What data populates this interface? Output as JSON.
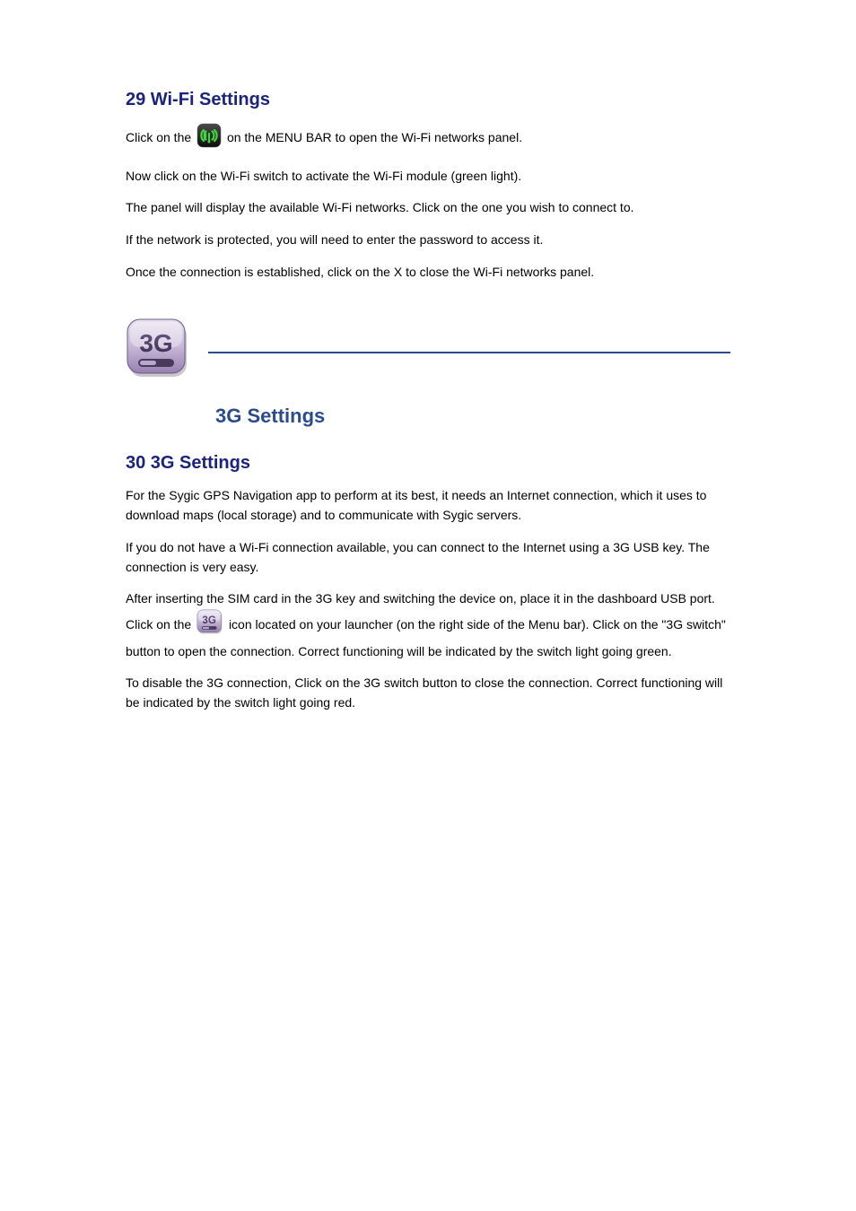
{
  "wifi": {
    "heading": "29 Wi-Fi Settings",
    "p1_a": "Click on the ",
    "p1_b": " on the MENU BAR to open the Wi-Fi networks panel.",
    "p2": "Now click on the Wi-Fi switch to activate the Wi-Fi module (green light).",
    "p3": "The panel will display the available Wi-Fi networks. Click on the one you wish to connect to.",
    "p4": "If the network is protected, you will need to enter the password to access it.",
    "p5": "Once the connection is established, click on the X to close the Wi-Fi networks panel."
  },
  "threeg": {
    "section_title": "3G Settings",
    "heading": "30 3G Settings",
    "p1": "For the Sygic GPS Navigation app to perform at its best, it needs an Internet connection, which it uses to download maps (local storage) and to communicate with Sygic servers.",
    "p2": "If you do not have a Wi-Fi connection available, you can connect to the Internet using a 3G USB key. The connection is very easy.",
    "p3_a": "After inserting the SIM card in the 3G key and switching the device on, place it in the dashboard USB port. Click on the ",
    "p3_b": " icon located on your launcher (on the right side of the Menu bar). Click on the \"3G switch\" button to open the connection. Correct functioning will be indicated by the switch light going green.",
    "p4": "To disable the 3G connection, Click on the 3G switch button to close the connection. Correct functioning will be indicated by the switch light going red."
  }
}
